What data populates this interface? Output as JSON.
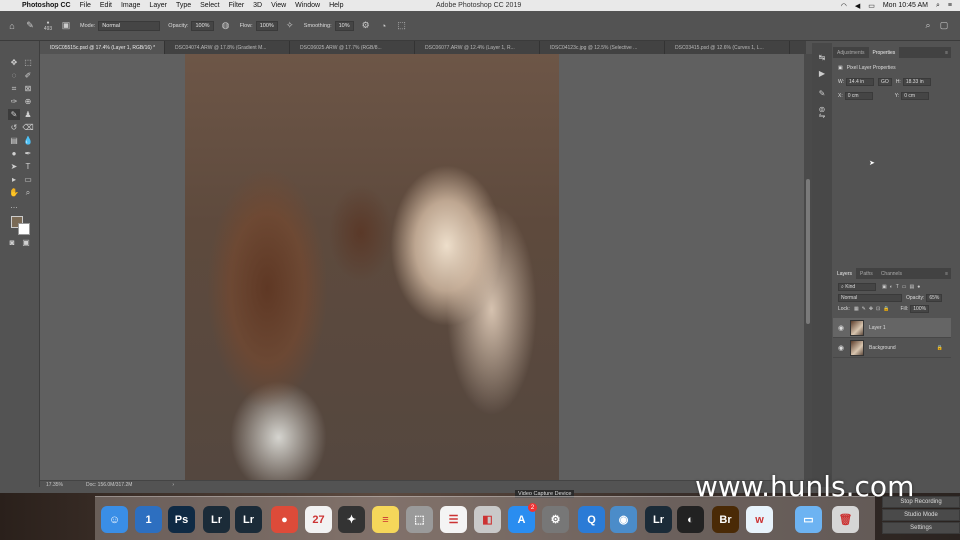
{
  "menubar": {
    "app": "Photoshop CC",
    "items": [
      "File",
      "Edit",
      "Image",
      "Layer",
      "Type",
      "Select",
      "Filter",
      "3D",
      "View",
      "Window",
      "Help"
    ],
    "window_title": "Adobe Photoshop CC 2019",
    "clock": "Mon 10:45 AM"
  },
  "options": {
    "brush_size": "493",
    "mode_label": "Mode:",
    "mode_value": "Normal",
    "opacity_label": "Opacity:",
    "opacity_value": "100%",
    "flow_label": "Flow:",
    "flow_value": "100%",
    "smoothing_label": "Smoothing:",
    "smoothing_value": "10%"
  },
  "tabs": [
    {
      "label": "IDSC05515c.psd @ 17.4% (Layer 1, RGB/16) *"
    },
    {
      "label": "DSC04074.ARW @ 17.8% (Gradient M..."
    },
    {
      "label": "DSC06025.ARW @ 17.7% (RGB/8..."
    },
    {
      "label": "DSC06077.ARW @ 12.4% (Layer 1, R..."
    },
    {
      "label": "IDSC04123c.jpg @ 12.5% (Selective ..."
    },
    {
      "label": "DSC03415.psd @ 12.6% (Curves 1, L..."
    }
  ],
  "status": {
    "zoom": "17.35%",
    "doc": "Doc: 156.0M/317.2M"
  },
  "properties": {
    "tabs": [
      "Adjustments",
      "Properties"
    ],
    "title": "Pixel Layer Properties",
    "w_label": "W:",
    "w_value": "14.4 in",
    "h_label": "H:",
    "h_value": "18.33 in",
    "link_label": "GO",
    "x_label": "X:",
    "x_value": "0 cm",
    "y_label": "Y:",
    "y_value": "0 cm"
  },
  "layers": {
    "tabs": [
      "Layers",
      "Paths",
      "Channels"
    ],
    "kind": "Kind",
    "blend": "Normal",
    "opacity_label": "Opacity:",
    "opacity_value": "65%",
    "lock_label": "Lock:",
    "fill_label": "Fill:",
    "fill_value": "100%",
    "items": [
      {
        "name": "Layer 1"
      },
      {
        "name": "Background"
      }
    ]
  },
  "dock": {
    "icons": [
      {
        "name": "finder-icon",
        "glyph": "☺",
        "color": "#3a8ee6"
      },
      {
        "name": "1password-icon",
        "glyph": "1",
        "color": "#2d6fc0"
      },
      {
        "name": "photoshop-icon",
        "glyph": "Ps",
        "color": "#0f2a44"
      },
      {
        "name": "lightroom-icon",
        "glyph": "Lr",
        "color": "#1b2b38"
      },
      {
        "name": "lightroom-classic-icon",
        "glyph": "Lr",
        "color": "#1b2b38"
      },
      {
        "name": "chrome-icon",
        "glyph": "●",
        "color": "#dd4b39"
      },
      {
        "name": "calendar-icon",
        "glyph": "27",
        "color": "#f2f2f2"
      },
      {
        "name": "final-cut-icon",
        "glyph": "✦",
        "color": "#333"
      },
      {
        "name": "notes-icon",
        "glyph": "≡",
        "color": "#f5d75a"
      },
      {
        "name": "screenshot-icon",
        "glyph": "⬚",
        "color": "#9a9a9a"
      },
      {
        "name": "reminders-icon",
        "glyph": "☰",
        "color": "#f4f4f4"
      },
      {
        "name": "preview-icon",
        "glyph": "◧",
        "color": "#c9c9c9"
      },
      {
        "name": "app-store-icon",
        "glyph": "A",
        "color": "#2a8df0"
      },
      {
        "name": "system-preferences-icon",
        "glyph": "⚙",
        "color": "#777"
      },
      {
        "name": "quicktime-icon",
        "glyph": "Q",
        "color": "#2b7bd6"
      },
      {
        "name": "image-capture-icon",
        "glyph": "◉",
        "color": "#4b8cc9"
      },
      {
        "name": "lightroom-icon-2",
        "glyph": "Lr",
        "color": "#1b2b38"
      },
      {
        "name": "obs-icon",
        "glyph": "◐",
        "color": "#222"
      },
      {
        "name": "bridge-icon",
        "glyph": "Br",
        "color": "#4a2a06"
      },
      {
        "name": "wunderlist-icon",
        "glyph": "w",
        "color": "#e8f3fb"
      },
      {
        "name": "downloads-folder-icon",
        "glyph": "▭",
        "color": "#6db3f2"
      },
      {
        "name": "trash-icon",
        "glyph": "🗑",
        "color": "#d6d6d6"
      }
    ],
    "badge": "2"
  },
  "obs": {
    "stop_recording": "Stop Recording",
    "studio_mode": "Studio Mode",
    "settings": "Settings"
  },
  "video_capture": "Video Capture Device",
  "watermark": "www.hunls.com"
}
